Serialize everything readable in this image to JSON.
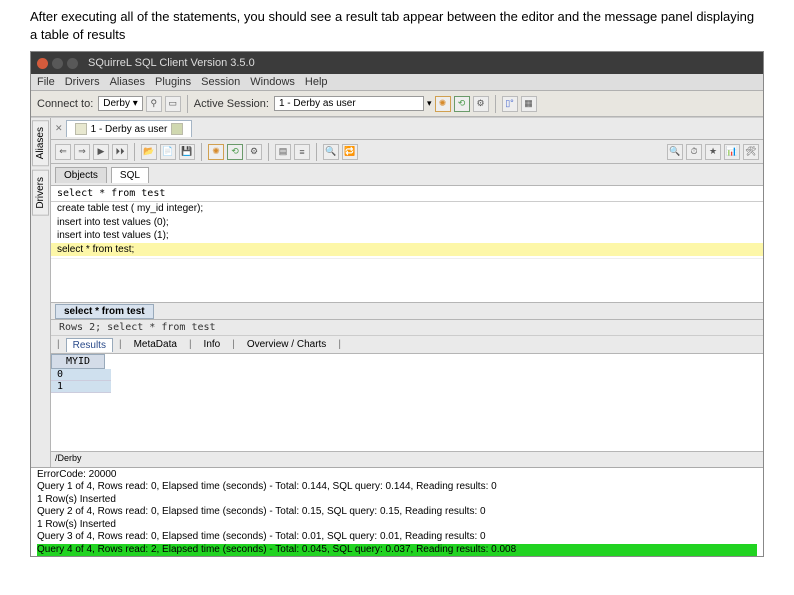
{
  "intro_text": "After executing all of the statements, you should see a result tab appear between the editor  and the message panel displaying a table of results",
  "titlebar": {
    "title": "SQuirreL SQL Client Version 3.5.0"
  },
  "menubar": {
    "items": [
      "File",
      "Drivers",
      "Aliases",
      "Plugins",
      "Session",
      "Windows",
      "Help"
    ]
  },
  "conn_toolbar": {
    "connect_label": "Connect to:",
    "connect_value": "Derby",
    "active_label": "Active Session:",
    "active_value": "1 - Derby as user"
  },
  "side_tabs": [
    "Aliases",
    "Drivers"
  ],
  "session_tab": {
    "label": "1 - Derby as user"
  },
  "object_tabs": {
    "tab1": "Objects",
    "tab2": "SQL"
  },
  "sql_input": "select * from test",
  "editor_lines": [
    "create table test ( my_id integer);",
    "insert into test values (0);",
    "insert into test values (1);",
    "select * from test;"
  ],
  "result_tab": {
    "label": "select * from test"
  },
  "rowcount_line": "Rows 2;   select * from test",
  "sub_tabs": [
    "Results",
    "MetaData",
    "Info",
    "Overview / Charts"
  ],
  "grid": {
    "header": "MYID",
    "rows": [
      "0",
      "1"
    ]
  },
  "pager": "/Derby",
  "error_code_line": "ErrorCode: 20000",
  "messages": [
    "Query 1 of 4, Rows read: 0, Elapsed time (seconds) - Total: 0.144, SQL query: 0.144, Reading results: 0",
    "1 Row(s) Inserted",
    "Query 2 of 4, Rows read: 0, Elapsed time (seconds) - Total: 0.15, SQL query: 0.15, Reading results: 0",
    "1 Row(s) Inserted",
    "Query 3 of 4, Rows read: 0, Elapsed time (seconds) - Total: 0.01, SQL query: 0.01, Reading results: 0",
    "Query 4 of 4, Rows read: 2, Elapsed time (seconds) - Total: 0.045, SQL query: 0.037, Reading results: 0.008"
  ]
}
